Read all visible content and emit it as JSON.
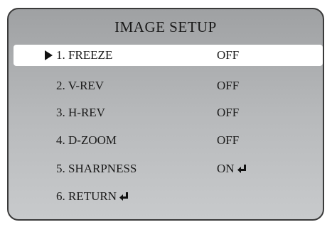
{
  "menu": {
    "title": "IMAGE SETUP",
    "items": [
      {
        "label": "1. FREEZE",
        "value": "OFF",
        "selected": true
      },
      {
        "label": "2. V-REV",
        "value": "OFF"
      },
      {
        "label": "3. H-REV",
        "value": "OFF"
      },
      {
        "label": "4. D-ZOOM",
        "value": "OFF"
      },
      {
        "label": "5. SHARPNESS",
        "value": "ON",
        "value_icon": "enter-icon"
      },
      {
        "label": "6. RETURN",
        "label_icon": "enter-icon"
      }
    ]
  }
}
